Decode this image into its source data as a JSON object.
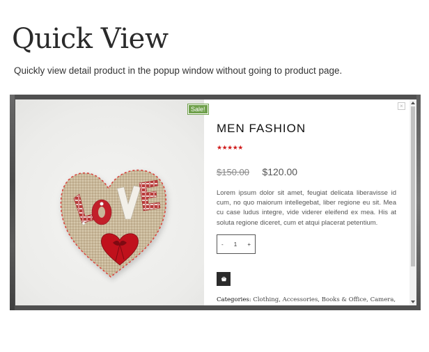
{
  "page": {
    "title": "Quick View",
    "subtitle": "Quickly view detail product in the popup window without going to product page."
  },
  "popup": {
    "sale_badge": "Sale!",
    "close_glyph": "×",
    "product": {
      "name": "MEN FASHION",
      "rating_stars": "★★★★★",
      "rating": 5,
      "old_price": "$150.00",
      "price": "$120.00",
      "description": "Lorem ipsum dolor sit amet, feugiat delicata liberavisse id cum, no quo maiorum intellegebat, liber regione eu sit. Mea cu case ludus integre, vide viderer eleifend ex mea. His at soluta regione diceret, cum et atqui placerat petentium.",
      "quantity": "1",
      "qty_minus": "-",
      "qty_plus": "+",
      "categories_label": "Categories:",
      "categories_value": "Clothing, Accessories, Books & Office, Camera,"
    },
    "image_text": "LOVE",
    "cart_icon": "cart-icon"
  },
  "colors": {
    "sale": "#6fa04b",
    "rating": "#d01c1c",
    "overlay": "#505050"
  }
}
